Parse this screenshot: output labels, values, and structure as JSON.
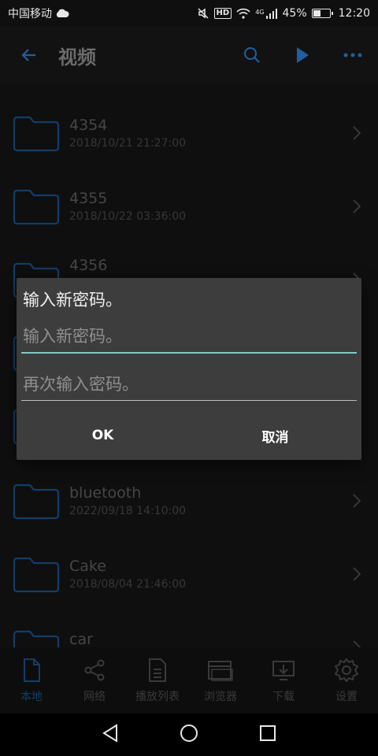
{
  "status_bar": {
    "carrier": "中国移动",
    "hd": "HD",
    "network": "4G",
    "battery_percent": "45%",
    "battery_level": 0.45,
    "time": "12:20"
  },
  "header": {
    "title": "视频",
    "icons": [
      "back-arrow-icon",
      "search-icon",
      "play-icon",
      "more-icon"
    ]
  },
  "folders": [
    {
      "name": "4354",
      "date": "2018/10/21 21:27:00"
    },
    {
      "name": "4355",
      "date": "2018/10/22 03:36:00"
    },
    {
      "name": "4356",
      "date": ""
    },
    {
      "name": "",
      "date": ""
    },
    {
      "name": "",
      "date": ""
    },
    {
      "name": "bluetooth",
      "date": "2022/09/18 14:10:00"
    },
    {
      "name": "Cake",
      "date": "2018/08/04 21:46:00"
    },
    {
      "name": "car",
      "date": ""
    }
  ],
  "dialog": {
    "title": "输入新密码。",
    "new_password_placeholder": "输入新密码。",
    "confirm_password_placeholder": "再次输入密码。",
    "ok_label": "OK",
    "cancel_label": "取消"
  },
  "bottom_nav": [
    {
      "label": "本地",
      "icon": "file-icon",
      "active": true
    },
    {
      "label": "网络",
      "icon": "share-icon",
      "active": false
    },
    {
      "label": "播放列表",
      "icon": "playlist-doc-icon",
      "active": false
    },
    {
      "label": "浏览器",
      "icon": "browser-window-icon",
      "active": false
    },
    {
      "label": "下载",
      "icon": "download-icon",
      "active": false
    },
    {
      "label": "设置",
      "icon": "gear-icon",
      "active": false
    }
  ],
  "colors": {
    "accent_blue": "#1f5fa0",
    "input_focus": "#80cbc4",
    "dialog_bg": "#3d3d3d"
  }
}
